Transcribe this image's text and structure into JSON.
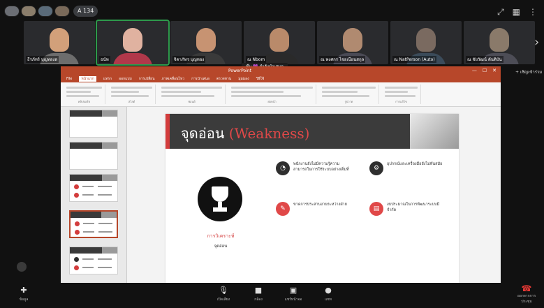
{
  "app": {
    "participant_count": "A 134"
  },
  "tiles": [
    {
      "name": "ธีรภัทร์ บุญทองล",
      "face": "#d2a07a",
      "body": "#6d6d6d"
    },
    {
      "name": "ธนัท",
      "face": "#e0b2a0",
      "body": "#b1384a",
      "active": true
    },
    {
      "name": "จิดาภัทร บุญทอง",
      "face": "#c79372",
      "body": "#3a3a3a"
    },
    {
      "name": "ณ Nbom",
      "face": "#b98a6a",
      "body": "#2a2a2a"
    },
    {
      "name": "ณ พงศกร ไชยเนียนสกุล",
      "face": "#b08a70",
      "body": "#4a4a55"
    },
    {
      "name": "ณ NatPerson (Auto)",
      "face": "#7a6a60",
      "body": "#3b4b5a"
    },
    {
      "name": "ณ ชัยวัฒน์ ตันติบัน",
      "face": "#8a7a6a",
      "body": "#4d4d56"
    }
  ],
  "presenter_label": "ชุ๊น 💜 กำลังนำเสนอ",
  "screen": {
    "window_title": "PowerPoint",
    "ribbon_tabs": [
      "File",
      "หน้าแรก",
      "แทรก",
      "ออกแบบ",
      "การเปลี่ยน",
      "ภาพเคลื่อนไหว",
      "การนำเสนอ",
      "ตรวจทาน",
      "มุมมอง",
      "วิธีใช้"
    ],
    "ribbon_groups": [
      "คลิปบอร์ด",
      "สไลด์",
      "ฟอนต์",
      "ย่อหน้า",
      "รูปวาด",
      "การแก้ไข"
    ]
  },
  "slide": {
    "title_th": "จุดอ่อน",
    "title_en": "(Weakness)",
    "caption_red": "การวิเคราะห์",
    "caption_dark": "จุดอ่อน",
    "items": [
      {
        "text": "พนักงานยังไม่มีความรู้ความสามารถในการใช้ระบบอย่างเต็มที่",
        "icon": "chart-icon",
        "color": "dark"
      },
      {
        "text": "อุปกรณ์และเครื่องมือยังไม่ทันสมัย",
        "icon": "gear-icon",
        "color": "dark"
      },
      {
        "text": "ขาดการประสานงานระหว่างฝ่าย",
        "icon": "pencil-icon",
        "color": "red"
      },
      {
        "text": "งบประมาณในการพัฒนาระบบมีจำกัด",
        "icon": "book-icon",
        "color": "red"
      }
    ]
  },
  "side_panel_button": "+ เชิญเข้าร่วม",
  "toolbar": {
    "mic": "เปิดเสียง",
    "camera": "กล้อง",
    "share": "แชร์หน้าจอ",
    "chat": "แชท",
    "left": "ข้อมูล",
    "leave": "ออกจากการประชุม"
  },
  "colors": {
    "accent": "#b7472a",
    "slide_red": "#e04848",
    "active_tile": "#2e9a4c"
  }
}
